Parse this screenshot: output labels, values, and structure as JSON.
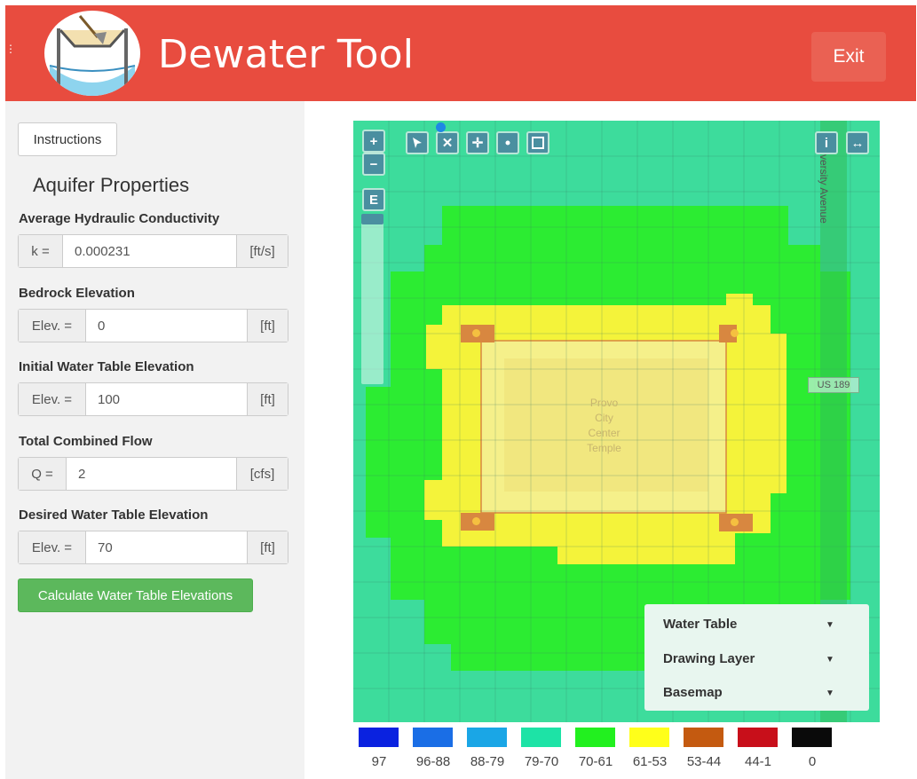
{
  "header": {
    "title": "Dewater Tool",
    "exit_label": "Exit",
    "brand_color": "#e84c3f"
  },
  "sidebar": {
    "instructions_label": "Instructions",
    "section_title": "Aquifer Properties",
    "fields": [
      {
        "label": "Average Hydraulic Conductivity",
        "prefix": "k =",
        "value": "0.000231",
        "unit": "[ft/s]"
      },
      {
        "label": "Bedrock Elevation",
        "prefix": "Elev. =",
        "value": "0",
        "unit": "[ft]"
      },
      {
        "label": "Initial Water Table Elevation",
        "prefix": "Elev. =",
        "value": "100",
        "unit": "[ft]"
      },
      {
        "label": "Total Combined Flow",
        "prefix": "Q =",
        "value": "2",
        "unit": "[cfs]"
      },
      {
        "label": "Desired Water Table Elevation",
        "prefix": "Elev. =",
        "value": "70",
        "unit": "[ft]"
      }
    ],
    "calculate_label": "Calculate Water Table Elevations"
  },
  "map": {
    "zoom_in": "+",
    "zoom_out": "−",
    "e_button": "E",
    "info_button": "i",
    "expand_icon": "↔",
    "road_name": "University Avenue",
    "highway_shield": "US 189",
    "site_lines": [
      "Provo",
      "City",
      "Center",
      "Temple"
    ],
    "tools": [
      "select-icon",
      "delete-icon",
      "move-icon",
      "point-icon",
      "rectangle-icon"
    ]
  },
  "layers": [
    {
      "label": "Water Table"
    },
    {
      "label": "Drawing Layer"
    },
    {
      "label": "Basemap"
    }
  ],
  "legend": [
    {
      "label": "97",
      "color": "#0a22e0"
    },
    {
      "label": "96-88",
      "color": "#1a6ee6"
    },
    {
      "label": "88-79",
      "color": "#1aa6e6"
    },
    {
      "label": "79-70",
      "color": "#1de3a6"
    },
    {
      "label": "70-61",
      "color": "#22f01f"
    },
    {
      "label": "61-53",
      "color": "#ffff1a"
    },
    {
      "label": "53-44",
      "color": "#c45a10"
    },
    {
      "label": "44-1",
      "color": "#c80f1a"
    },
    {
      "label": "0",
      "color": "#0a0a0a"
    }
  ]
}
